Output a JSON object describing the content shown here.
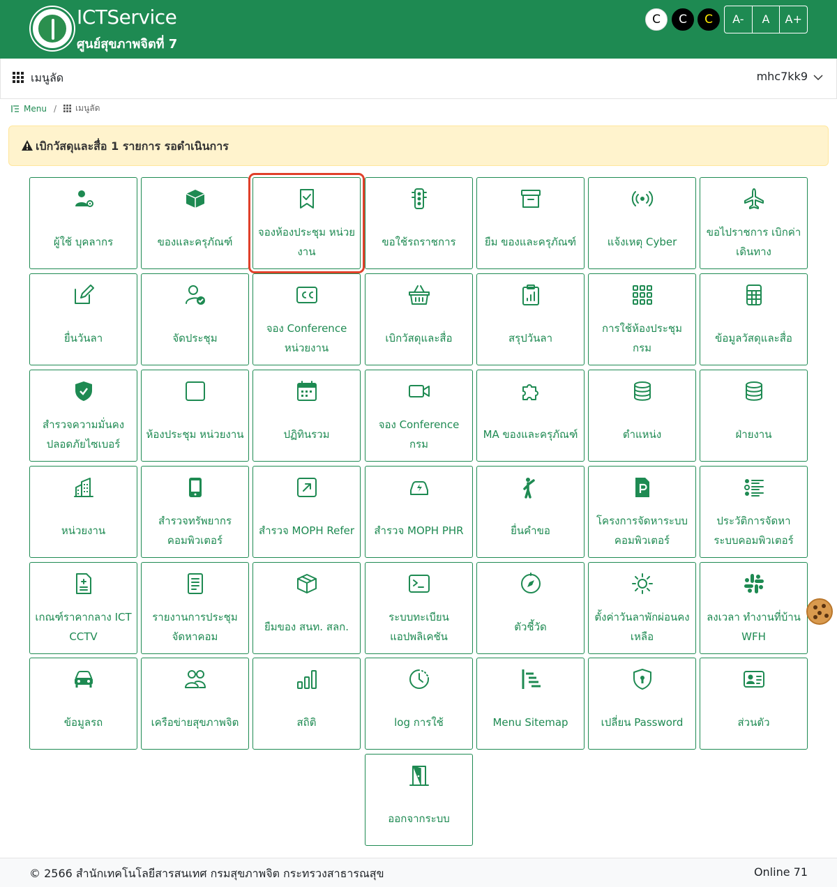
{
  "header": {
    "brand_title": "ICTService",
    "brand_subtitle": "ศูนย์สุขภาพจิตที่ 7",
    "contrast_buttons": [
      "C",
      "C",
      "C"
    ],
    "font_buttons": [
      "A-",
      "A",
      "A+"
    ]
  },
  "nav": {
    "title": "เมนูลัด",
    "user": "mhc7kk9"
  },
  "breadcrumb": {
    "root": "Menu",
    "separator": "/",
    "current": "เมนูลัด"
  },
  "alert": {
    "text": "เบิกวัสดุและสื่อ 1 รายการ รอดำเนินการ"
  },
  "tiles": [
    {
      "label": "ผู้ใช้ บุคลากร",
      "icon": "user-gear-icon"
    },
    {
      "label": "ของและครุภัณฑ์",
      "icon": "box-icon"
    },
    {
      "label": "จองห้องประชุม หน่วยงาน",
      "icon": "bookmark-check-icon"
    },
    {
      "label": "ขอใช้รถราชการ",
      "icon": "traffic-light-icon"
    },
    {
      "label": "ยืม ของและครุภัณฑ์",
      "icon": "archive-icon"
    },
    {
      "label": "แจ้งเหตุ Cyber",
      "icon": "broadcast-icon"
    },
    {
      "label": "ขอไปราชการ เบิกค่าเดินทาง",
      "icon": "airplane-icon"
    },
    {
      "label": "ยื่นวันลา",
      "icon": "pencil-square-icon"
    },
    {
      "label": "จัดประชุม",
      "icon": "user-check-icon"
    },
    {
      "label": "จอง Conference หน่วยงาน",
      "icon": "cc-icon"
    },
    {
      "label": "เบิกวัสดุและสื่อ",
      "icon": "basket-icon"
    },
    {
      "label": "สรุปวันลา",
      "icon": "clipboard-chart-icon"
    },
    {
      "label": "การใช้ห้องประชุม กรม",
      "icon": "grid-icon"
    },
    {
      "label": "ข้อมูลวัสดุและสื่อ",
      "icon": "calculator-icon"
    },
    {
      "label": "สำรวจความมั่นคงปลอดภัยไซเบอร์",
      "icon": "shield-check-icon"
    },
    {
      "label": "ห้องประชุม หน่วยงาน",
      "icon": "square-icon"
    },
    {
      "label": "ปฏิทินรวม",
      "icon": "calendar-icon"
    },
    {
      "label": "จอง Conference กรม",
      "icon": "video-icon"
    },
    {
      "label": "MA ของและครุภัณฑ์",
      "icon": "puzzle-icon"
    },
    {
      "label": "ตำแหน่ง",
      "icon": "database-icon"
    },
    {
      "label": "ฝ่ายงาน",
      "icon": "database-icon"
    },
    {
      "label": "หน่วยงาน",
      "icon": "building-icon"
    },
    {
      "label": "สำรวจทรัพยากรคอมพิวเตอร์",
      "icon": "device-icon"
    },
    {
      "label": "สำรวจ MOPH Refer",
      "icon": "arrow-up-right-square-icon"
    },
    {
      "label": "สำรวจ MOPH PHR",
      "icon": "ev-car-icon"
    },
    {
      "label": "ยื่นคำขอ",
      "icon": "person-raise-icon"
    },
    {
      "label": "โครงการจัดหาระบบคอมพิวเตอร์",
      "icon": "file-p-icon"
    },
    {
      "label": "ประวัติการจัดหาระบบคอมพิวเตอร์",
      "icon": "list-icon"
    },
    {
      "label": "เกณฑ์ราคากลาง ICT CCTV",
      "icon": "file-medical-icon"
    },
    {
      "label": "รายงานการประชุม จัดหาคอม",
      "icon": "file-text-icon"
    },
    {
      "label": "ยืมของ สนท. สลก.",
      "icon": "box-outline-icon"
    },
    {
      "label": "ระบบทะเบียนแอปพลิเคชัน",
      "icon": "terminal-icon"
    },
    {
      "label": "ตัวชี้วัด",
      "icon": "compass-icon"
    },
    {
      "label": "ตั้งค่าวันลาพักผ่อนคงเหลือ",
      "icon": "sun-icon"
    },
    {
      "label": "ลงเวลา ทำงานที่บ้าน WFH",
      "icon": "slack-icon"
    },
    {
      "label": "ข้อมูลรถ",
      "icon": "car-icon"
    },
    {
      "label": "เครือข่ายสุขภาพจิต",
      "icon": "people-icon"
    },
    {
      "label": "สถิติ",
      "icon": "bar-chart-icon"
    },
    {
      "label": "log การใช้",
      "icon": "clock-history-icon"
    },
    {
      "label": "Menu Sitemap",
      "icon": "sitemap-icon"
    },
    {
      "label": "เปลี่ยน Password",
      "icon": "shield-lock-icon"
    },
    {
      "label": "ส่วนตัว",
      "icon": "person-vcard-icon"
    },
    {
      "label": "ออกจากระบบ",
      "icon": "door-open-icon"
    }
  ],
  "footer": {
    "copyright": "© 2566 สำนักเทคโนโลยีสารสนเทศ กรมสุขภาพจิต กระทรวงสาธารณสุข",
    "online": "Online 71"
  },
  "colors": {
    "primary": "#1e8a52",
    "alert_bg": "#fff3cd",
    "highlight": "#e0402a"
  }
}
